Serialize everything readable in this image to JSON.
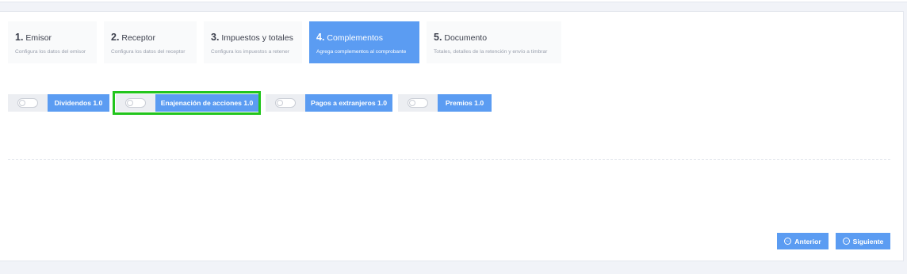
{
  "steps": [
    {
      "num": "1.",
      "title": "Emisor",
      "desc": "Configura los datos del emisor",
      "active": false
    },
    {
      "num": "2.",
      "title": "Receptor",
      "desc": "Configura los datos del receptor",
      "active": false
    },
    {
      "num": "3.",
      "title": "Impuestos y totales",
      "desc": "Configura los impuestos a retener",
      "active": false
    },
    {
      "num": "4.",
      "title": "Complementos",
      "desc": "Agrega complementos al comprobante",
      "active": true
    },
    {
      "num": "5.",
      "title": "Documento",
      "desc": "Totales, detalles de la retención y envío a timbrar",
      "active": false
    }
  ],
  "complements": [
    {
      "label": "Dividendos 1.0",
      "enabled": false
    },
    {
      "label": "Enajenación de acciones 1.0",
      "enabled": false
    },
    {
      "label": "Pagos a extranjeros 1.0",
      "enabled": false
    },
    {
      "label": "Premios 1.0",
      "enabled": false
    }
  ],
  "nav": {
    "prev_label": "Anterior",
    "next_label": "Siguiente",
    "prev_icon": "arrow-left-circle-icon",
    "next_icon": "arrow-right-circle-icon"
  },
  "colors": {
    "accent": "#5b9cf2",
    "highlight": "#22c51c"
  }
}
